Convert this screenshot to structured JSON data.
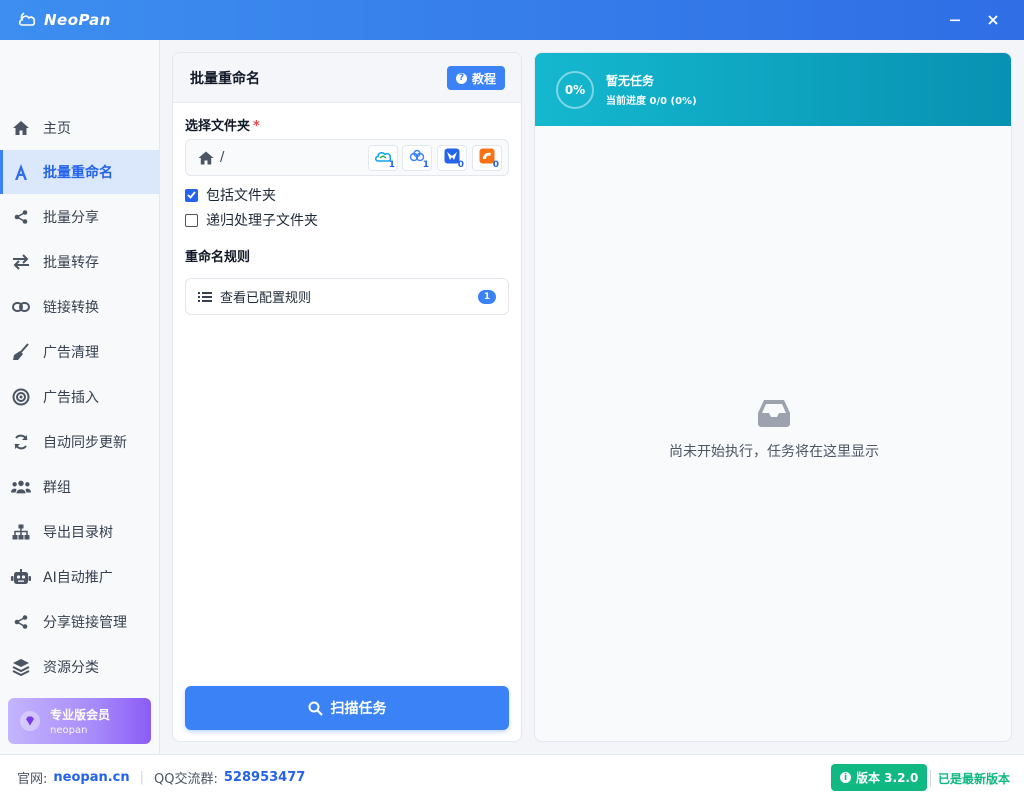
{
  "app": {
    "title": "NeoPan"
  },
  "sidebar": {
    "items": [
      {
        "label": "主页",
        "icon": "home-icon"
      },
      {
        "label": "批量重命名",
        "icon": "font-a-icon",
        "active": true
      },
      {
        "label": "批量分享",
        "icon": "share-icon"
      },
      {
        "label": "批量转存",
        "icon": "transfer-icon"
      },
      {
        "label": "链接转换",
        "icon": "link-icon"
      },
      {
        "label": "广告清理",
        "icon": "broom-icon"
      },
      {
        "label": "广告插入",
        "icon": "target-icon"
      },
      {
        "label": "自动同步更新",
        "icon": "sync-icon"
      },
      {
        "label": "群组",
        "icon": "users-icon"
      },
      {
        "label": "导出目录树",
        "icon": "sitemap-icon"
      },
      {
        "label": "AI自动推广",
        "icon": "robot-icon"
      },
      {
        "label": "分享链接管理",
        "icon": "share-icon"
      },
      {
        "label": "资源分类",
        "icon": "layers-icon"
      }
    ],
    "pro": {
      "title": "专业版会员",
      "subtitle": "neopan"
    }
  },
  "rename_panel": {
    "title": "批量重命名",
    "tutorial_label": "教程",
    "folder_label": "选择文件夹",
    "required_mark": "*",
    "path": "/",
    "drives": [
      {
        "icon": "cloud-drive-icon",
        "count": "1"
      },
      {
        "icon": "cloud-drive-2-icon",
        "count": "1"
      },
      {
        "icon": "blue-drive-icon",
        "count": "0"
      },
      {
        "icon": "orange-drive-icon",
        "count": "0"
      }
    ],
    "include_folders": {
      "label": "包括文件夹",
      "checked": true
    },
    "recursive": {
      "label": "递归处理子文件夹",
      "checked": false
    },
    "rules_title": "重命名规则",
    "view_rules_label": "查看已配置规则",
    "rules_count": "1",
    "scan_label": "扫描任务"
  },
  "task_panel": {
    "progress": "0%",
    "status": "暂无任务",
    "progress_text": "当前进度 0/0 (0%)",
    "empty_message": "尚未开始执行，任务将在这里显示"
  },
  "footer": {
    "site_label": "官网:",
    "site_link": "neopan.cn",
    "qq_label": "QQ交流群:",
    "qq_value": "528953477",
    "version": "版本 3.2.0",
    "latest": "已是最新版本"
  },
  "colors": {
    "accent": "#3b82f6",
    "titlebar": "#2f6ee5",
    "task_header": "#0891b2",
    "success": "#10b981",
    "pro": "#a78bfa"
  }
}
